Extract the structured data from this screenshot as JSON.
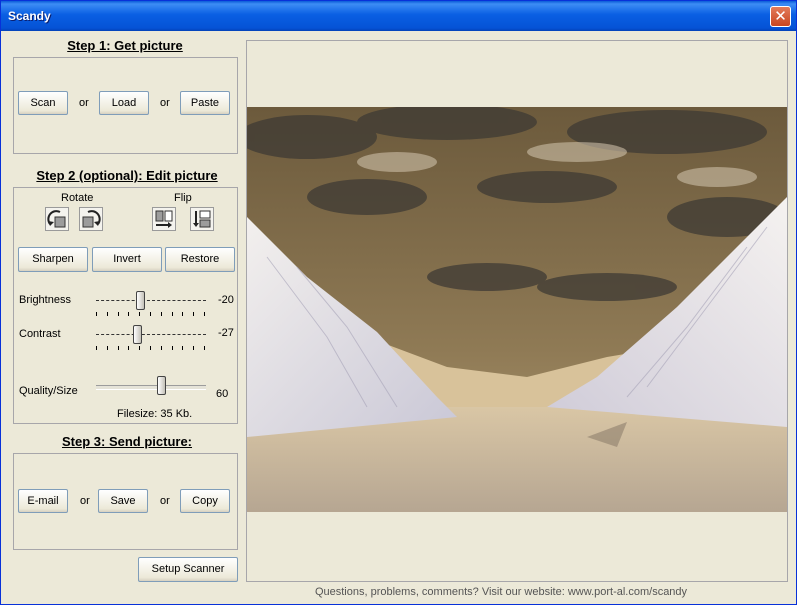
{
  "window": {
    "title": "Scandy",
    "close_icon": "close-icon"
  },
  "step1": {
    "heading": "Step 1: Get picture",
    "scan": "Scan",
    "load": "Load",
    "paste": "Paste",
    "or": "or"
  },
  "step2": {
    "heading": "Step 2 (optional): Edit picture",
    "rotate_label": "Rotate",
    "flip_label": "Flip",
    "sharpen": "Sharpen",
    "invert": "Invert",
    "restore": "Restore",
    "brightness": {
      "label": "Brightness",
      "value": "-20",
      "level": -20,
      "min": -100,
      "max": 100
    },
    "contrast": {
      "label": "Contrast",
      "value": "-27",
      "level": -27,
      "min": -100,
      "max": 100
    },
    "quality": {
      "label": "Quality/Size",
      "value": "60",
      "level": 60,
      "min": 0,
      "max": 100
    },
    "filesize": "Filesize: 35 Kb."
  },
  "step3": {
    "heading": "Step 3: Send picture:",
    "email": "E-mail",
    "save": "Save",
    "copy": "Copy",
    "or": "or"
  },
  "setup_scanner": "Setup Scanner",
  "footer": "Questions, problems, comments? Visit our website: www.port-al.com/scandy",
  "colors": {
    "titlebar": "#0a5fe3",
    "sky": "#8a7550",
    "snow": "#e6e2dc",
    "water": "#c9b8a0"
  }
}
